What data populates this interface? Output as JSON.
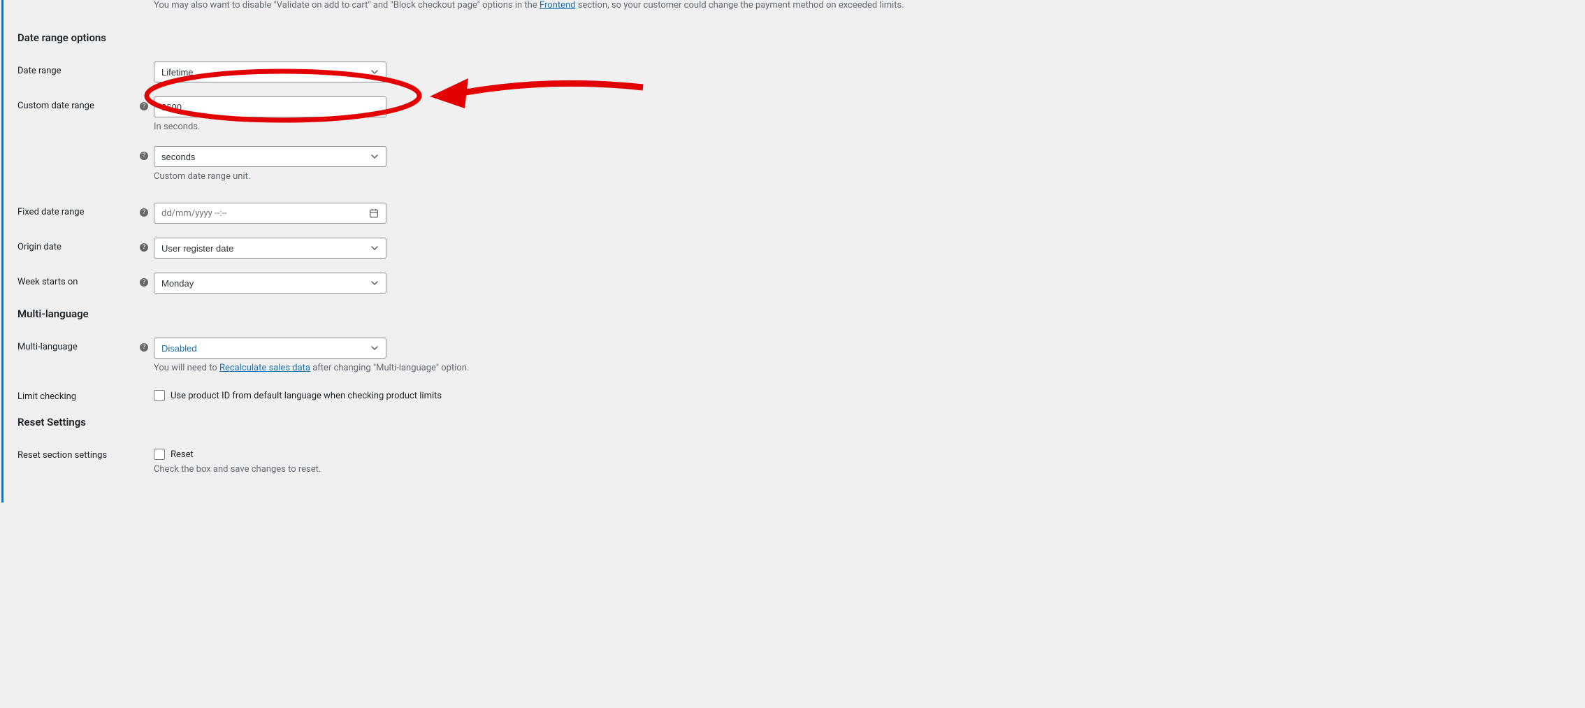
{
  "top_description": {
    "prefix": "You may also want to disable \"Validate on add to cart\" and \"Block checkout page\" options in the ",
    "link_text": "Frontend",
    "suffix": " section, so your customer could change the payment method on exceeded limits."
  },
  "sections": {
    "date_range_options": {
      "heading": "Date range options",
      "fields": {
        "date_range": {
          "label": "Date range",
          "value": "Lifetime"
        },
        "custom_date_range": {
          "label": "Custom date range",
          "value": "3600",
          "description": "In seconds."
        },
        "custom_date_range_unit": {
          "value": "seconds",
          "description": "Custom date range unit."
        },
        "fixed_date_range": {
          "label": "Fixed date range",
          "placeholder": "dd/mm/yyyy --:--"
        },
        "origin_date": {
          "label": "Origin date",
          "value": "User register date"
        },
        "week_starts_on": {
          "label": "Week starts on",
          "value": "Monday"
        }
      }
    },
    "multi_language": {
      "heading": "Multi-language",
      "fields": {
        "multi_language": {
          "label": "Multi-language",
          "value": "Disabled",
          "description_prefix": "You will need to ",
          "description_link": "Recalculate sales data",
          "description_suffix": " after changing \"Multi-language\" option."
        },
        "limit_checking": {
          "label": "Limit checking",
          "checkbox_label": "Use product ID from default language when checking product limits"
        }
      }
    },
    "reset_settings": {
      "heading": "Reset Settings",
      "fields": {
        "reset_section_settings": {
          "label": "Reset section settings",
          "checkbox_label": "Reset",
          "description": "Check the box and save changes to reset."
        }
      }
    }
  }
}
